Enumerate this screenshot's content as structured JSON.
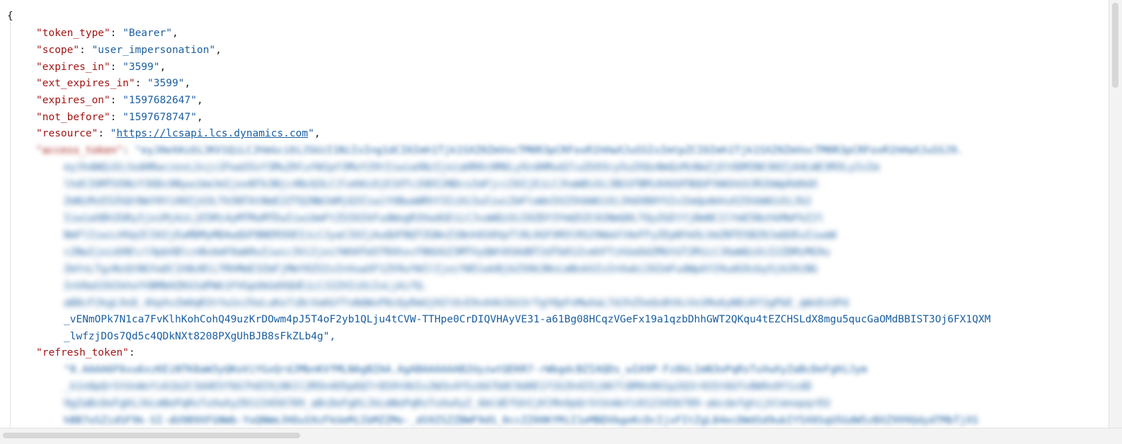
{
  "json": {
    "open_brace": "{",
    "fields": [
      {
        "key": "\"token_type\"",
        "value": "\"Bearer\""
      },
      {
        "key": "\"scope\"",
        "value": "\"user_impersonation\""
      },
      {
        "key": "\"expires_in\"",
        "value": "\"3599\""
      },
      {
        "key": "\"ext_expires_in\"",
        "value": "\"3599\""
      },
      {
        "key": "\"expires_on\"",
        "value": "\"1597682647\""
      },
      {
        "key": "\"not_before\"",
        "value": "\"1597678747\""
      },
      {
        "key": "\"resource\"",
        "value_prefix": "\"",
        "link": "https://lcsapi.lcs.dynamics.com",
        "value_suffix": "\""
      }
    ],
    "access_token": {
      "key": "\"access_token\"",
      "first_line": "\"eyJ0eXAiOiJKV1QiLCJhbGciOiJSUzI1NiIsIng1dCI6Imh1Tjk1SXZ0ZmVocTM0R3pCRFoxR1hHaXJuSSIsImtpZCI6Imh1Tjk1SXZ0ZmVocTM0R3pCRFoxR1hHaXJuSSJ9.",
      "lines": [
        "eyJhdWQiOiJodHRwczovL2xjc2FwaS5sY3MuZHluYW1pY3MuY29tIiwiaXNzIjoiaHR0cHM6Ly9zdHMud2luZG93cy5uZXQvNmQzMzBmZjEtODM3NC00ZjA4LWE3M3LyIsIm",
        "lhdCI6MTU5NzY3ODc0NywibmJmIjoxNTk3Njc4NzQ3LCJleHAiOjE1OTc2ODI2NDcsImFjciI6IjEiLCJhaW8iOiJBU1FBMi84UUFBQUFVWGhGS3R2bWpRd0dX",
        "ZmNiMzE5ZGQtNmY0Yi00ZjU3LTk5NTAtNmE2ZTQ2NWJmMjQ3IiwiYXBwaWRhY3IiOiIwIiwiZmFtaWx5X25hbWUiOiJHdXB0YSIsImdpdmVuX25hbWUiOiJb2",
        "IiwiaXBhZGRyIjoiMjAzLjE5Mi4yMTMuMTEwIiwibmFtZSI6IkFudWogR3VwdGEiLCJvaWQiOiI0ZDY3YmQ5ZC02NmQ0LTQyZGEtYjBmNC1lYmE5NzhkMmFkZJl",
        "NmFlIiwicHVpZCI6IjEwMDMyMDAwQUFBNEM3OEIiLCJyaCI6IjAuQUFBQTZGNnZ1Nnh6S0VpTlRLOGFXM3lRS29WaVlHeFFyZEpNYm5LVmZNTE5BZ0JaQUEuIiwaW",
        "c2NwIjoidXNlcl9pbXBlcnNvbmF0aW9uIiwic3ViIjoiYWhHTm5TRXhxcFB6UGZ3MTVyQWt0S0dBT2dTb01ZcmhFTzhGeDdZMUtGT2MiLCJ0aWQiOiI2ZDMzMG9u",
        "ZmYxLTgzNzQtNGYwOC1hNzNlLTRhMmE3ZmFjMmY0ZSIsInVuaXF1ZV9uYW1lIjoiYW51akBjb250b3NvLmNvbSIsInVwbiI6ImFudWpAY29udG9zby5jb20iNG",
        "InV0aSI6IkhoYVBMbHZKU1dPWk1FVGpUbGdXQUEiLCJ2ZXIiOiIxLjAifQ.",
        "aB8cF2kgL9sD_4hpXvZm0qR3tYw1nJ5eLuKo7iBcVa6GfTsNdWxP8zQyRmUjH2lOcE9vA4kIbS3rTgY0pFnMwXaL7dJhZ5eQsBtKcVo1Mu6yN8iRf2gPbE_qWxDzUPd"
      ],
      "tail_lines": [
        "_vENmOPk7N1ca7FvKlhKohCohQ49uzKrDOwm4pJ5T4oF2yb1QLju4tCVW-TTHpe0CrDIQVHAyVE31-a61Bg08HCqzVGeFx19a1qzbDhhGWT2QKqu4tEZCHSLdX8mgu5qucGaOMdBBIST3Oj6FX1QXM",
        "_lwfzjDOs7Qd5c4QDkNXt8208PXgUhBJB8sFkZLb4g\","
      ]
    },
    "refresh_token": {
      "key": "\"refresh_token\"",
      "lines": [
        "\"0.AAAA6F6vu6xzKEiNTK8aW3yQKoViYGxQrdJMbnKVfMLNAgBZAA.AgABAAAAAAB2UyzwtQEKR7-rWbgdcBZIAQDs_wIA9P-Fz8kL1mN3oPqRsTuVwXyZaBcDeFgHiJym",
        "_k1n0pQrStUvWxYzA1b2C3d4E5f6G7h8I9j0K1l2M3n4O5p6Q7r8S9t0U1v2W3x4Y5z6A7b8C9d0E1f2G3h4I5j6K7l8M9n0O1p2Q3r4S5t6U7v8W9x0Y1zdD",
        "9gZaBcDeFgHiJkLmNoPqRsTuVwXyZ0123456789_aBcDeFgHiJkLmNoPqRsTuVwXyZ_AbCdEfGhIjKlMnOpQrStUvWxYz0123456789-abcdefghijklmnopqrEU",
        "hBB7oSZidSF9k-SI-dU9B9XFGNWb-YoQNWeJHOuS9zFkUeMiIbMZZMo-_dS9ZSZZBWF9dS_0ccZZ00KYMiI1eMBDVbgeKcDcIjxFItZgL84ecDWdSd9ubIY5X0SqU5GdW5zBXZ999QdydTMbTjXS"
      ]
    }
  }
}
